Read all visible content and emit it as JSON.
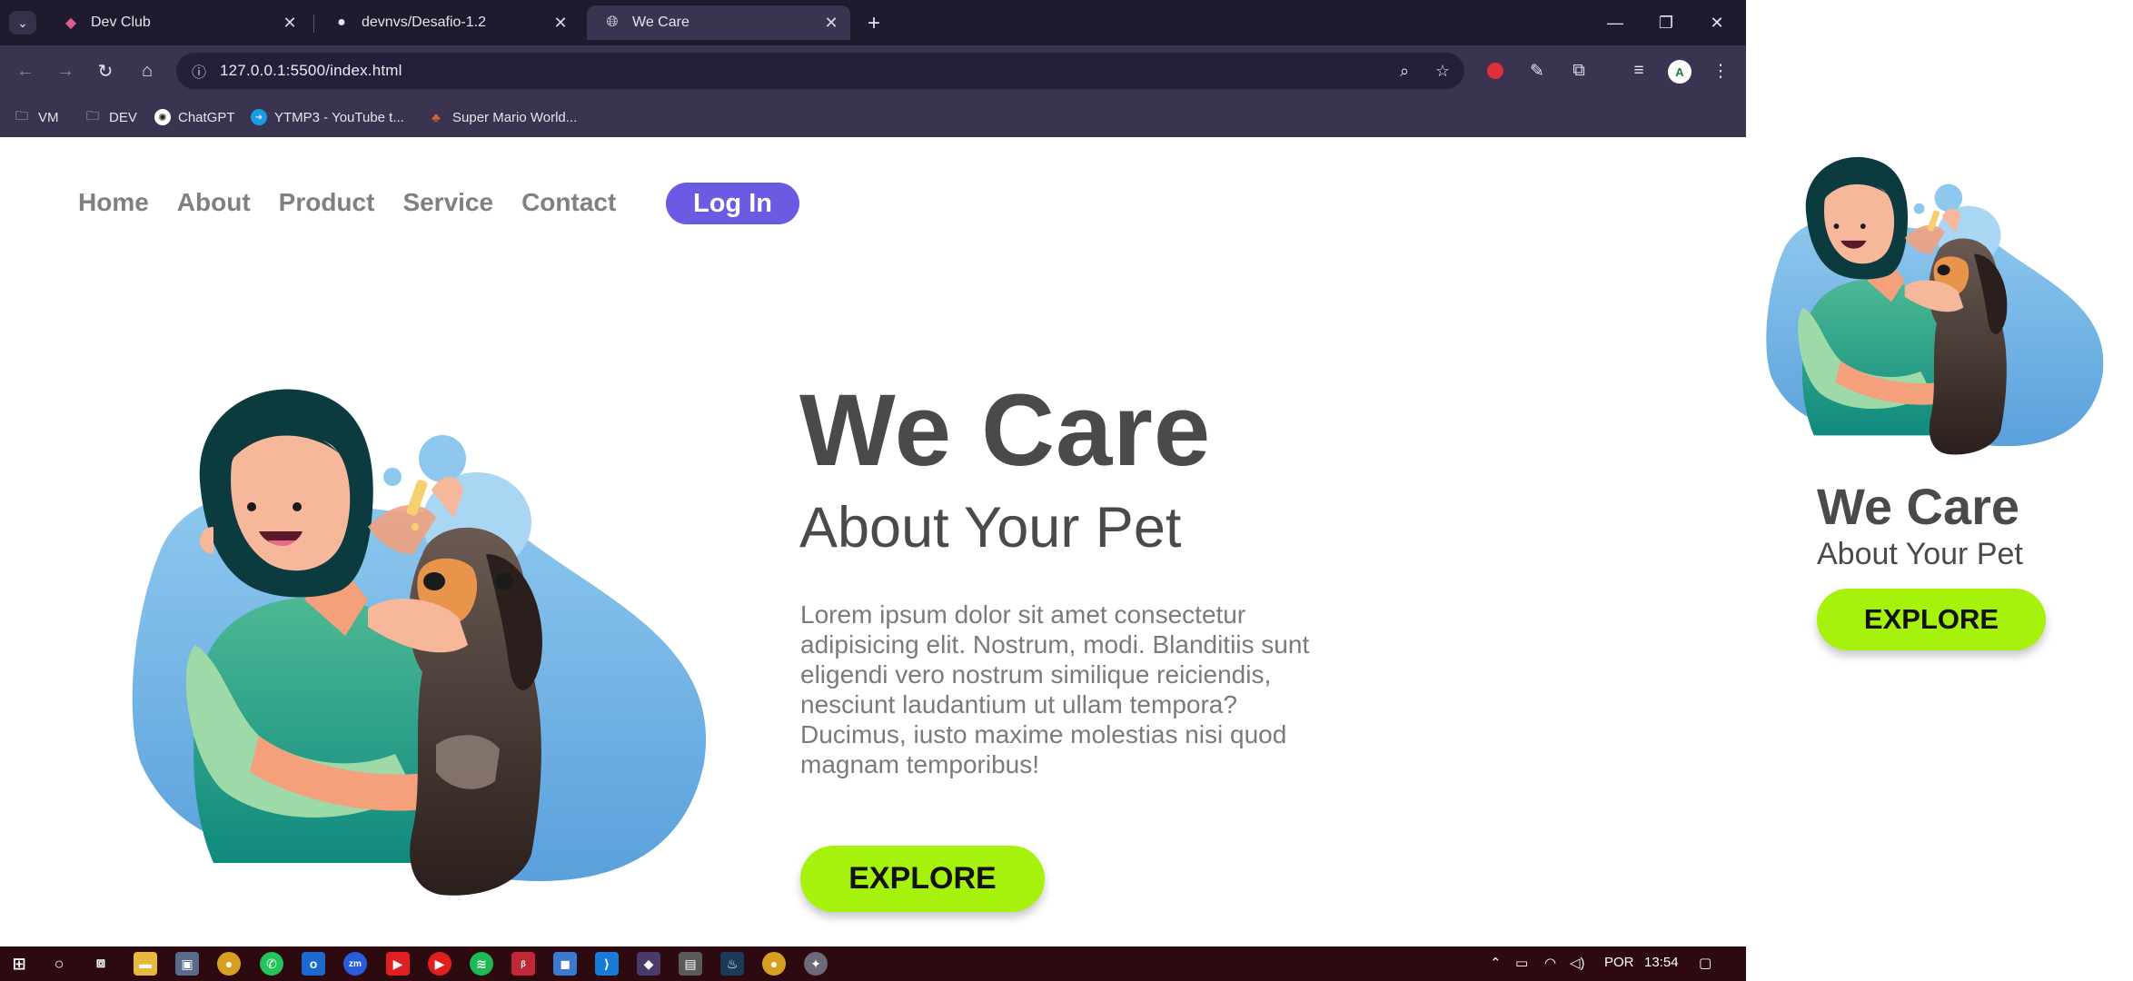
{
  "browser": {
    "tabs": [
      {
        "title": "Dev Club",
        "favicon": "devclub-icon",
        "active": false
      },
      {
        "title": "devnvs/Desafio-1.2",
        "favicon": "github-icon",
        "active": false
      },
      {
        "title": "We Care",
        "favicon": "globe-icon",
        "active": true
      }
    ],
    "url": "127.0.0.1:5500/index.html",
    "bookmarks": [
      {
        "label": "VM",
        "icon": "folder-icon"
      },
      {
        "label": "DEV",
        "icon": "folder-icon"
      },
      {
        "label": "ChatGPT",
        "icon": "chatgpt-icon"
      },
      {
        "label": "YTMP3 - YouTube t...",
        "icon": "ytmp3-icon"
      },
      {
        "label": "Super Mario World...",
        "icon": "mario-icon"
      }
    ],
    "profile_initial": "A"
  },
  "nav": {
    "links": [
      "Home",
      "About",
      "Product",
      "Service",
      "Contact"
    ],
    "login_label": "Log In"
  },
  "hero": {
    "title": "We Care",
    "subtitle": "About Your Pet",
    "body": "Lorem ipsum dolor sit amet consectetur adipisicing elit. Nostrum, modi. Blanditiis sunt eligendi vero nostrum similique reiciendis, nesciunt laudantium ut ullam tempora? Ducimus, iusto maxime molestias nisi quod magnam temporibus!",
    "explore_label": "EXPLORE"
  },
  "mobile_preview": {
    "title": "We Care",
    "subtitle": "About Your Pet",
    "explore_label": "EXPLORE"
  },
  "taskbar": {
    "language": "POR",
    "time": "13:54"
  },
  "colors": {
    "chrome_bg": "#1f1a2e",
    "toolbar_bg": "#3a3450",
    "login_btn": "#6b5be3",
    "explore_btn": "#a6f20c",
    "heading": "#4a4a4a",
    "taskbar_bg": "#2d0a10"
  }
}
